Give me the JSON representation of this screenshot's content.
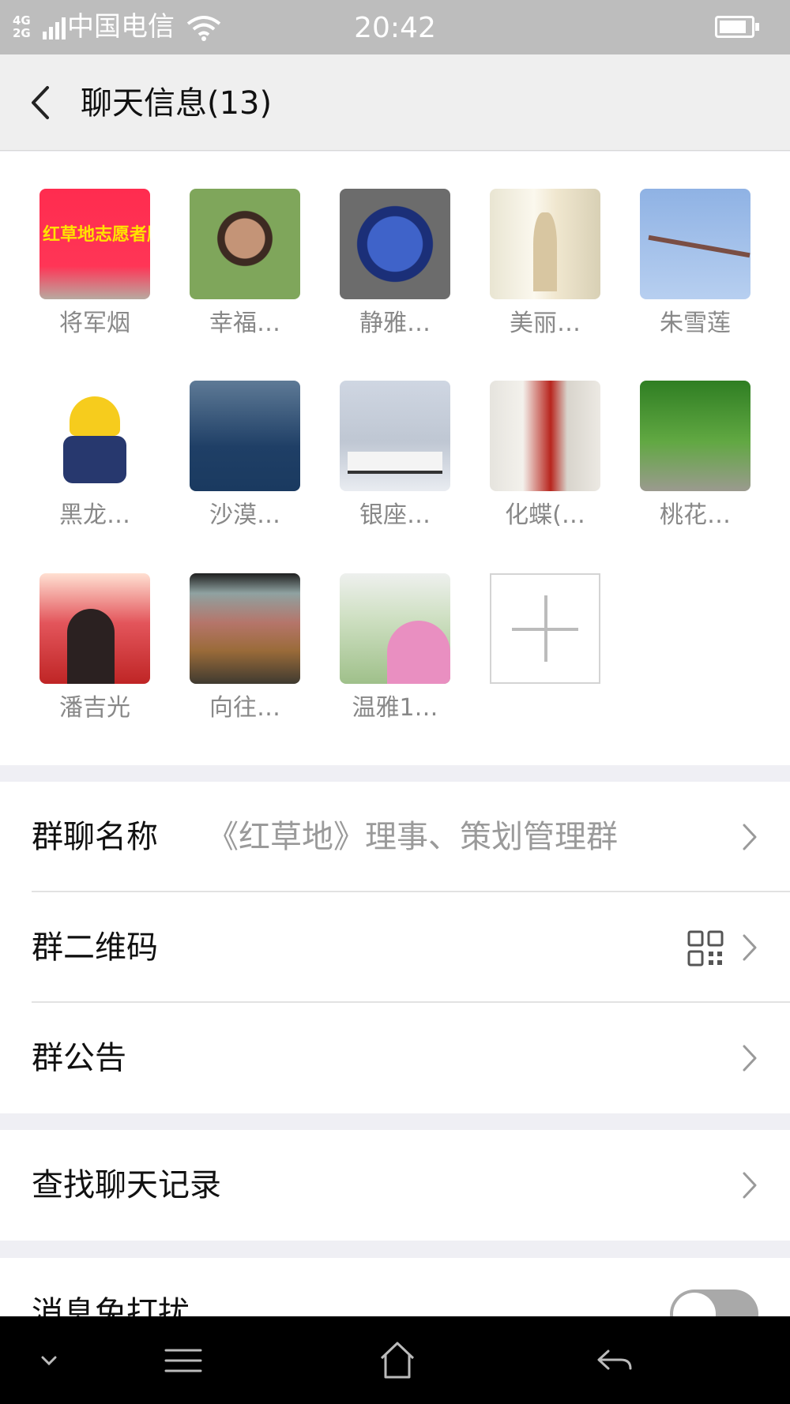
{
  "status_bar": {
    "network": "4G\n2G",
    "carrier": "中国电信",
    "time": "20:42"
  },
  "header": {
    "title": "聊天信息(13)",
    "back_icon": "chevron-left-icon"
  },
  "members": [
    {
      "name": "将军烟",
      "avatar_text": "红草地志愿者服务队"
    },
    {
      "name": "幸福…"
    },
    {
      "name": "静雅…"
    },
    {
      "name": "美丽…"
    },
    {
      "name": "朱雪莲"
    },
    {
      "name": "黑龙…"
    },
    {
      "name": "沙漠…"
    },
    {
      "name": "银座…"
    },
    {
      "name": "化蝶(…"
    },
    {
      "name": "桃花…"
    },
    {
      "name": "潘吉光"
    },
    {
      "name": "向往…"
    },
    {
      "name": "温雅1…"
    }
  ],
  "add_member_icon": "plus-icon",
  "settings": {
    "group_name": {
      "label": "群聊名称",
      "value": "《红草地》理事、策划管理群"
    },
    "qr_code": {
      "label": "群二维码",
      "icon": "qr-code-icon"
    },
    "announcement": {
      "label": "群公告"
    },
    "search_history": {
      "label": "查找聊天记录"
    },
    "do_not_disturb": {
      "label": "消息免打扰",
      "enabled": false
    }
  },
  "nav_bar": {
    "icons": [
      "chevron-down-icon",
      "menu-icon",
      "home-icon",
      "back-arrow-icon"
    ]
  },
  "colors": {
    "status_bar": "#bdbdbd",
    "title_bar": "#efefef",
    "background": "#efeff4",
    "nav_bar": "#000000"
  }
}
